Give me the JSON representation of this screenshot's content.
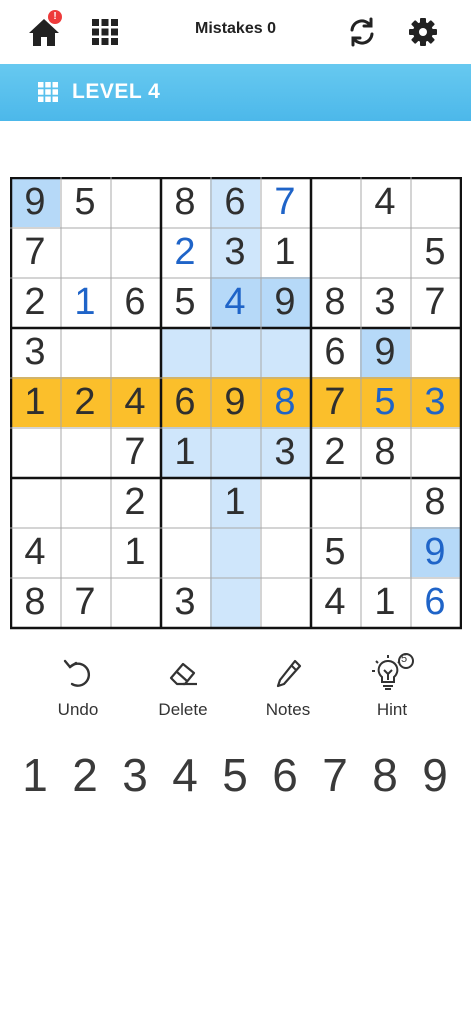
{
  "topbar": {
    "home_icon": "home-icon",
    "home_badge": "!",
    "grid_icon": "grid-icon",
    "mistakes_label": "Mistakes 0",
    "refresh_icon": "refresh-icon",
    "settings_icon": "gear-icon"
  },
  "banner": {
    "level": "LEVEL 4",
    "color": "#4cb8ea"
  },
  "board": {
    "cells": [
      [
        {
          "v": "9",
          "s": "g",
          "h": "sel"
        },
        {
          "v": "5",
          "s": "g"
        },
        {
          "v": "",
          "s": ""
        },
        {
          "v": "8",
          "s": "g"
        },
        {
          "v": "6",
          "s": "g",
          "h": "blue"
        },
        {
          "v": "7",
          "s": "u"
        },
        {
          "v": "",
          "s": ""
        },
        {
          "v": "4",
          "s": "g"
        },
        {
          "v": "",
          "s": ""
        }
      ],
      [
        {
          "v": "7",
          "s": "g"
        },
        {
          "v": "",
          "s": ""
        },
        {
          "v": "",
          "s": ""
        },
        {
          "v": "2",
          "s": "u"
        },
        {
          "v": "3",
          "s": "g",
          "h": "blue"
        },
        {
          "v": "1",
          "s": "g"
        },
        {
          "v": "",
          "s": ""
        },
        {
          "v": "",
          "s": ""
        },
        {
          "v": "5",
          "s": "g"
        }
      ],
      [
        {
          "v": "2",
          "s": "g"
        },
        {
          "v": "1",
          "s": "u"
        },
        {
          "v": "6",
          "s": "g"
        },
        {
          "v": "5",
          "s": "g"
        },
        {
          "v": "4",
          "s": "u",
          "h": "sel"
        },
        {
          "v": "9",
          "s": "g",
          "h": "sel"
        },
        {
          "v": "8",
          "s": "g"
        },
        {
          "v": "3",
          "s": "g"
        },
        {
          "v": "7",
          "s": "g"
        }
      ],
      [
        {
          "v": "3",
          "s": "g"
        },
        {
          "v": "",
          "s": ""
        },
        {
          "v": "",
          "s": ""
        },
        {
          "v": "",
          "s": "",
          "h": "blue"
        },
        {
          "v": "",
          "s": "",
          "h": "blue"
        },
        {
          "v": "",
          "s": "",
          "h": "blue"
        },
        {
          "v": "6",
          "s": "g"
        },
        {
          "v": "9",
          "s": "g",
          "h": "sel"
        },
        {
          "v": "",
          "s": ""
        }
      ],
      [
        {
          "v": "1",
          "s": "g",
          "h": "row"
        },
        {
          "v": "2",
          "s": "g",
          "h": "row"
        },
        {
          "v": "4",
          "s": "g",
          "h": "row"
        },
        {
          "v": "6",
          "s": "g",
          "h": "row"
        },
        {
          "v": "9",
          "s": "g",
          "h": "row"
        },
        {
          "v": "8",
          "s": "u",
          "h": "row"
        },
        {
          "v": "7",
          "s": "g",
          "h": "row"
        },
        {
          "v": "5",
          "s": "u",
          "h": "row"
        },
        {
          "v": "3",
          "s": "u",
          "h": "row"
        }
      ],
      [
        {
          "v": "",
          "s": ""
        },
        {
          "v": "",
          "s": ""
        },
        {
          "v": "7",
          "s": "g"
        },
        {
          "v": "1",
          "s": "g",
          "h": "blue"
        },
        {
          "v": "",
          "s": "",
          "h": "blue"
        },
        {
          "v": "3",
          "s": "g",
          "h": "blue"
        },
        {
          "v": "2",
          "s": "g"
        },
        {
          "v": "8",
          "s": "g"
        },
        {
          "v": "",
          "s": ""
        }
      ],
      [
        {
          "v": "",
          "s": ""
        },
        {
          "v": "",
          "s": ""
        },
        {
          "v": "2",
          "s": "g"
        },
        {
          "v": "",
          "s": ""
        },
        {
          "v": "1",
          "s": "g",
          "h": "blue"
        },
        {
          "v": "",
          "s": ""
        },
        {
          "v": "",
          "s": ""
        },
        {
          "v": "",
          "s": ""
        },
        {
          "v": "8",
          "s": "g"
        }
      ],
      [
        {
          "v": "4",
          "s": "g"
        },
        {
          "v": "",
          "s": ""
        },
        {
          "v": "1",
          "s": "g"
        },
        {
          "v": "",
          "s": ""
        },
        {
          "v": "",
          "s": "",
          "h": "blue"
        },
        {
          "v": "",
          "s": ""
        },
        {
          "v": "5",
          "s": "g"
        },
        {
          "v": "",
          "s": ""
        },
        {
          "v": "9",
          "s": "u",
          "h": "sel"
        }
      ],
      [
        {
          "v": "8",
          "s": "g"
        },
        {
          "v": "7",
          "s": "g"
        },
        {
          "v": "",
          "s": ""
        },
        {
          "v": "3",
          "s": "g"
        },
        {
          "v": "",
          "s": "",
          "h": "blue"
        },
        {
          "v": "",
          "s": ""
        },
        {
          "v": "4",
          "s": "g"
        },
        {
          "v": "1",
          "s": "g"
        },
        {
          "v": "6",
          "s": "u"
        }
      ]
    ],
    "colors": {
      "user_digit": "#1f64c8",
      "highlight": "#cfe6fb",
      "selected_match": "#b6d9f8",
      "active_row": "#fbbf2b"
    }
  },
  "actions": [
    {
      "label": "Undo",
      "icon": "undo-icon"
    },
    {
      "label": "Delete",
      "icon": "eraser-icon"
    },
    {
      "label": "Notes",
      "icon": "pencil-icon"
    },
    {
      "label": "Hint",
      "icon": "lightbulb-icon",
      "badge": "5"
    }
  ],
  "numpad": [
    "1",
    "2",
    "3",
    "4",
    "5",
    "6",
    "7",
    "8",
    "9"
  ]
}
